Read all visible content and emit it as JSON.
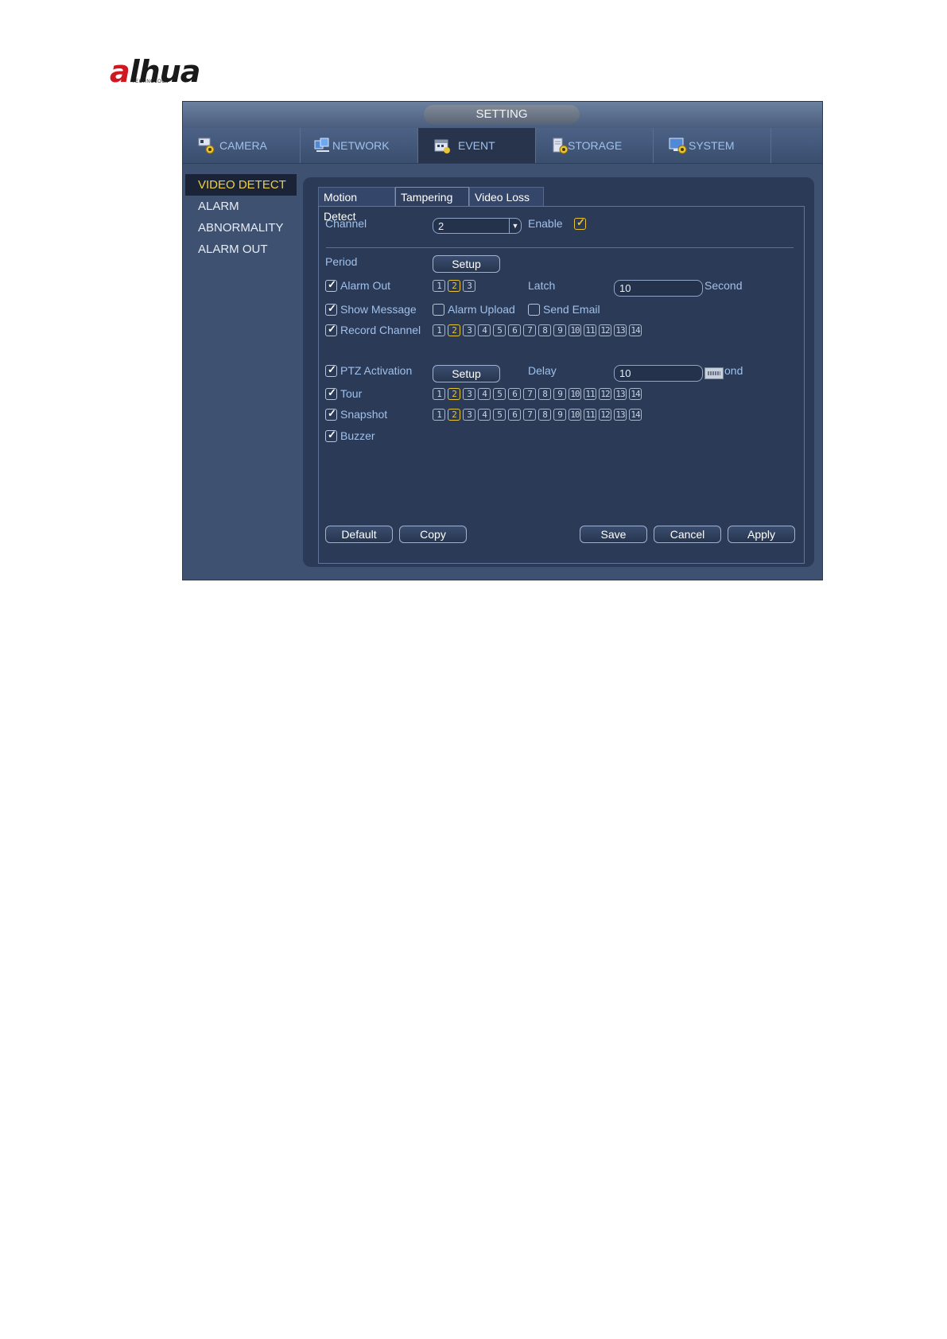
{
  "logo": {
    "brand": "alhua",
    "sub": "TECHNOLOGY"
  },
  "window": {
    "title": "SETTING"
  },
  "nav": [
    {
      "label": "CAMERA",
      "icon": "camera-gear-icon"
    },
    {
      "label": "NETWORK",
      "icon": "network-icon"
    },
    {
      "label": "EVENT",
      "icon": "event-icon"
    },
    {
      "label": "STORAGE",
      "icon": "storage-icon"
    },
    {
      "label": "SYSTEM",
      "icon": "system-icon"
    }
  ],
  "sidebar": [
    {
      "label": "VIDEO DETECT"
    },
    {
      "label": "ALARM"
    },
    {
      "label": "ABNORMALITY"
    },
    {
      "label": "ALARM OUT"
    }
  ],
  "tabs": [
    {
      "label": "Motion Detect"
    },
    {
      "label": "Tampering"
    },
    {
      "label": "Video Loss"
    }
  ],
  "form": {
    "channel_label": "Channel",
    "channel_value": "2",
    "enable_label": "Enable",
    "period_label": "Period",
    "setup_label": "Setup",
    "alarm_out_label": "Alarm Out",
    "alarm_out_channels": [
      "1",
      "2",
      "3"
    ],
    "latch_label": "Latch",
    "latch_value": "10",
    "second_label": "Second",
    "show_message_label": "Show Message",
    "alarm_upload_label": "Alarm Upload",
    "send_email_label": "Send Email",
    "record_channel_label": "Record Channel",
    "ptz_label": "PTZ Activation",
    "delay_label": "Delay",
    "delay_value": "10",
    "delay_unit": "ond",
    "tour_label": "Tour",
    "snapshot_label": "Snapshot",
    "buzzer_label": "Buzzer",
    "channels": [
      "1",
      "2",
      "3",
      "4",
      "5",
      "6",
      "7",
      "8",
      "9",
      "10",
      "11",
      "12",
      "13",
      "14"
    ]
  },
  "buttons": {
    "default": "Default",
    "copy": "Copy",
    "save": "Save",
    "cancel": "Cancel",
    "apply": "Apply"
  },
  "colors": {
    "accent": "#f0d040",
    "label": "#9fc1ec",
    "background": "#3e5170"
  }
}
